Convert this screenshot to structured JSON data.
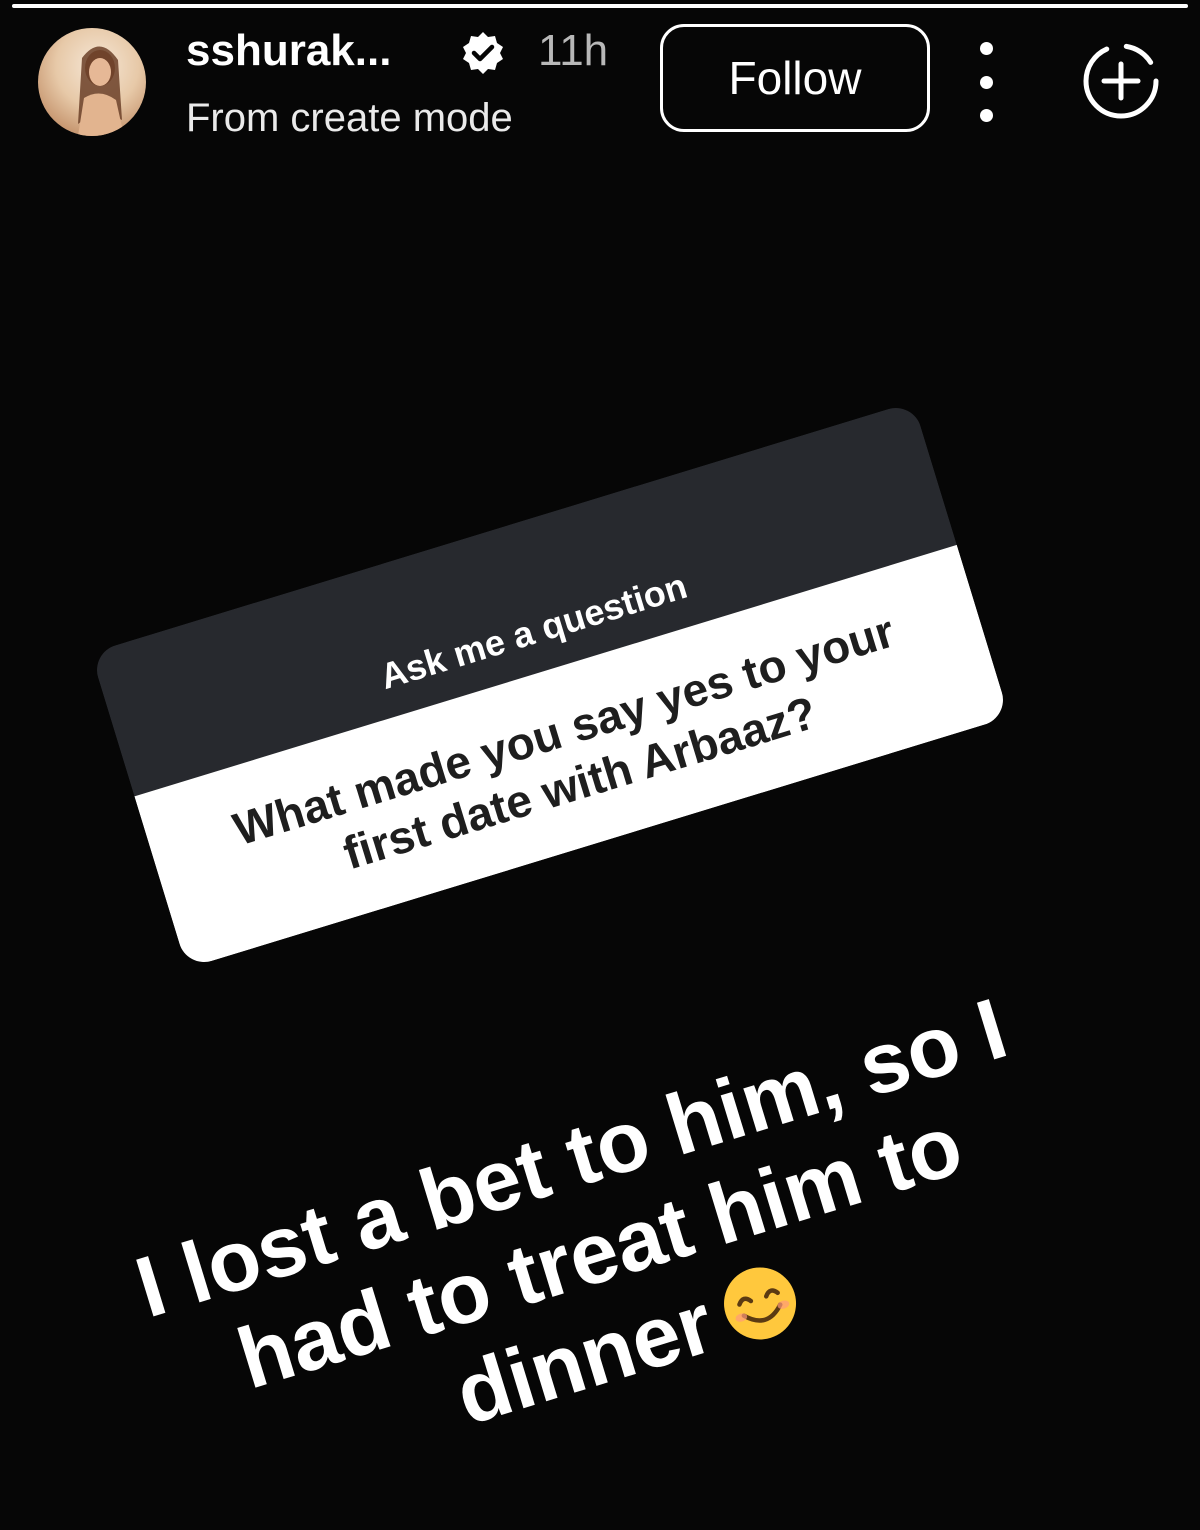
{
  "story": {
    "progress": 1.0
  },
  "header": {
    "username": "sshurak...",
    "verified_icon": "verified-badge-icon",
    "time": "11h",
    "subtitle": "From create mode",
    "follow_label": "Follow",
    "more_icon": "more-vertical-icon",
    "add_icon": "add-to-story-icon"
  },
  "question_sticker": {
    "title": "Ask me a question",
    "question": "What made you say yes to your first date with Arbaaz?"
  },
  "answer": {
    "text": "I lost a bet to him, so I had to treat him to dinner",
    "emoji": "smiling-face-icon"
  },
  "colors": {
    "background": "#060606",
    "sticker_header": "#27292e",
    "sticker_body": "#ffffff",
    "emoji_yellow": "#ffc83d"
  }
}
